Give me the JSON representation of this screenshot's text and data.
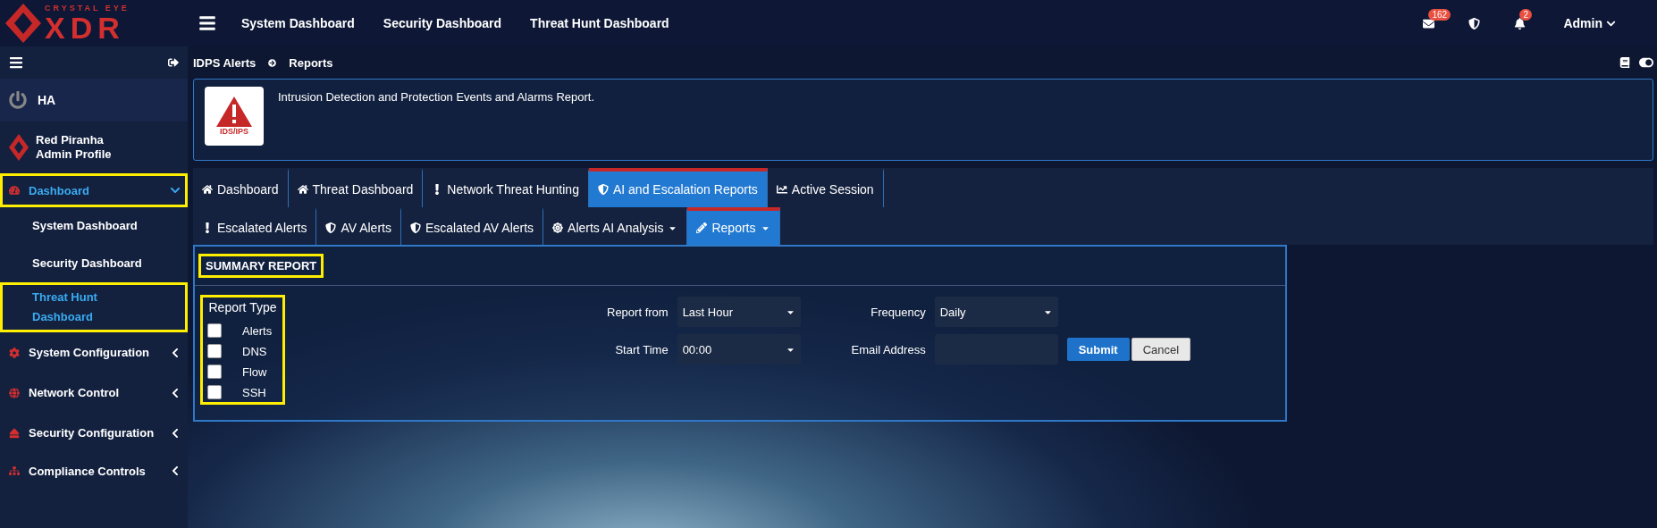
{
  "brand": {
    "tagline": "CRYSTAL EYE",
    "name": "XDR"
  },
  "top_nav": [
    {
      "label": "System Dashboard"
    },
    {
      "label": "Security Dashboard"
    },
    {
      "label": "Threat Hunt Dashboard"
    }
  ],
  "top_icons": [
    {
      "kind": "mail",
      "badge": "162"
    },
    {
      "kind": "shield"
    },
    {
      "kind": "bell",
      "badge": "2"
    }
  ],
  "user_menu": {
    "label": "Admin"
  },
  "sidebar": {
    "ha": {
      "label": "HA"
    },
    "profile": {
      "name": "Red Piranha",
      "role": "Admin Profile"
    },
    "items": [
      {
        "label": "Dashboard",
        "kind": "dashboard",
        "expanded": true,
        "selected": true,
        "highlighted": true,
        "children": [
          {
            "label": "System Dashboard",
            "selected": false,
            "highlighted": false
          },
          {
            "label": "Security Dashboard",
            "selected": false,
            "highlighted": false
          },
          {
            "label": "Threat Hunt Dashboard",
            "selected": true,
            "highlighted": true
          }
        ]
      },
      {
        "label": "System Configuration",
        "kind": "config",
        "expanded": false,
        "selected": false,
        "highlighted": false
      },
      {
        "label": "Network Control",
        "kind": "network",
        "expanded": false,
        "selected": false,
        "highlighted": false
      },
      {
        "label": "Security Configuration",
        "kind": "security",
        "expanded": false,
        "selected": false,
        "highlighted": false
      },
      {
        "label": "Compliance Controls",
        "kind": "compliance",
        "expanded": false,
        "selected": false,
        "highlighted": false
      }
    ]
  },
  "breadcrumb": [
    "IDPS Alerts",
    "Reports"
  ],
  "info": {
    "badge": "IDS/IPS",
    "text": "Intrusion Detection and Protection Events and Alarms Report."
  },
  "tabs": [
    {
      "label": "Dashboard",
      "kind": "home",
      "selected": false
    },
    {
      "label": "Threat Dashboard",
      "kind": "home",
      "selected": false
    },
    {
      "label": "Network Threat Hunting",
      "kind": "exclaim",
      "selected": false
    },
    {
      "label": "AI and Escalation Reports",
      "kind": "shield",
      "selected": true
    },
    {
      "label": "Active Session",
      "kind": "chart",
      "selected": false
    }
  ],
  "subtabs": [
    {
      "label": "Escalated Alerts",
      "kind": "exclaim",
      "selected": false,
      "dropdown": false
    },
    {
      "label": "AV Alerts",
      "kind": "shield",
      "selected": false,
      "dropdown": false
    },
    {
      "label": "Escalated AV Alerts",
      "kind": "shield",
      "selected": false,
      "dropdown": false
    },
    {
      "label": "Alerts AI Analysis",
      "kind": "aperture",
      "selected": false,
      "dropdown": true
    },
    {
      "label": "Reports",
      "kind": "pencil",
      "selected": true,
      "dropdown": true
    }
  ],
  "panel": {
    "title": "SUMMARY REPORT",
    "title_highlighted": true,
    "report_type": {
      "legend": "Report Type",
      "highlighted": true,
      "options": [
        {
          "label": "Alerts",
          "checked": false
        },
        {
          "label": "DNS",
          "checked": false
        },
        {
          "label": "Flow",
          "checked": false
        },
        {
          "label": "SSH",
          "checked": false
        }
      ]
    },
    "report_from": {
      "label": "Report from",
      "value": "Last Hour"
    },
    "frequency": {
      "label": "Frequency",
      "value": "Daily"
    },
    "start_time": {
      "label": "Start Time",
      "value": "00:00"
    },
    "email": {
      "label": "Email Address"
    },
    "buttons": [
      {
        "label": "Submit",
        "kind": "primary"
      },
      {
        "label": "Cancel",
        "kind": "secondary"
      }
    ]
  }
}
